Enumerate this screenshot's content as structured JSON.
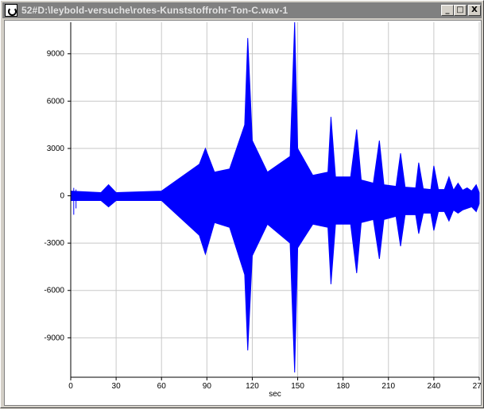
{
  "window": {
    "title": "52#D:\\leybold-versuche\\rotes-Kunststoffrohr-Ton-C.wav-1",
    "minimize_label": "_",
    "maximize_label": "□",
    "close_label": "X",
    "icon": "app-icon"
  },
  "chart_data": {
    "type": "area",
    "title": "",
    "xlabel": "sec",
    "ylabel": "",
    "xlim": [
      0,
      270
    ],
    "ylim": [
      -11500,
      11000
    ],
    "x_ticks": [
      0,
      30,
      60,
      90,
      120,
      150,
      180,
      210,
      240,
      270
    ],
    "x_tick_labels": [
      "0",
      "30",
      "60",
      "90",
      "120",
      "150",
      "180",
      "210",
      "240",
      "270"
    ],
    "y_ticks": [
      9000,
      6000,
      3000,
      0,
      -3000,
      -6000,
      -9000
    ],
    "y_tick_labels": [
      "9000",
      "6000",
      "3000",
      "0",
      "-3000",
      "-6000",
      "-9000"
    ],
    "grid": true,
    "series": [
      {
        "color": "#0000ff",
        "description_points": {
          "t": [
            0,
            20,
            25,
            30,
            60,
            85,
            89,
            95,
            105,
            115,
            117,
            120,
            130,
            145,
            148,
            150,
            160,
            170,
            172,
            175,
            185,
            189,
            192,
            200,
            204,
            207,
            215,
            218,
            221,
            228,
            230,
            233,
            238,
            240,
            243,
            247,
            250,
            253,
            256,
            259,
            262,
            265,
            268,
            270
          ],
          "upper": [
            300,
            200,
            700,
            200,
            300,
            2000,
            3000,
            1500,
            1700,
            4500,
            10000,
            3500,
            1500,
            2500,
            11000,
            3000,
            1300,
            1500,
            5000,
            1200,
            1200,
            4200,
            1000,
            800,
            3500,
            700,
            600,
            2700,
            550,
            500,
            2100,
            450,
            400,
            1900,
            400,
            400,
            1200,
            350,
            800,
            350,
            500,
            300,
            700,
            200
          ],
          "lower": [
            -300,
            -300,
            -700,
            -300,
            -300,
            -2500,
            -3700,
            -1700,
            -2000,
            -5000,
            -9800,
            -3800,
            -1800,
            -3000,
            -11200,
            -3300,
            -1800,
            -2000,
            -5600,
            -1800,
            -1800,
            -4900,
            -1700,
            -1500,
            -4000,
            -1500,
            -1300,
            -3200,
            -1200,
            -1200,
            -2400,
            -1100,
            -1100,
            -2200,
            -1000,
            -1000,
            -1600,
            -900,
            -1100,
            -900,
            -800,
            -700,
            -1000,
            -500
          ]
        }
      }
    ]
  }
}
